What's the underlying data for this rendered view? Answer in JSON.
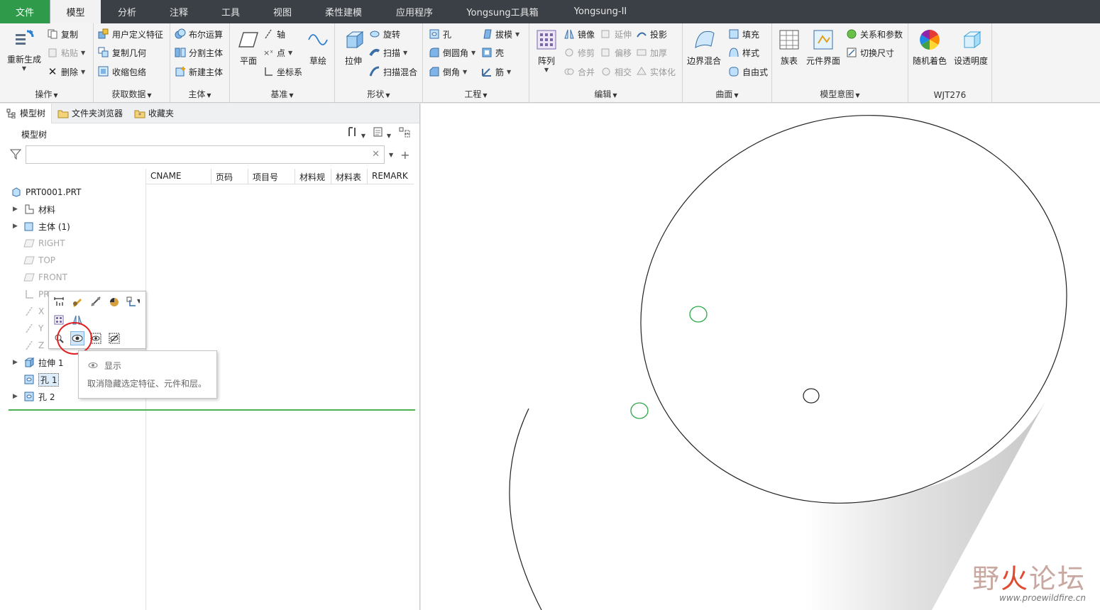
{
  "menu": {
    "tabs": [
      "文件",
      "模型",
      "分析",
      "注释",
      "工具",
      "视图",
      "柔性建模",
      "应用程序",
      "Yongsung工具箱",
      "Yongsung-II"
    ]
  },
  "ribbon": {
    "ops": {
      "footer": "操作",
      "regen": "重新生成",
      "copy": "复制",
      "paste": "粘贴",
      "delete": "删除"
    },
    "getdata": {
      "footer": "获取数据",
      "udf": "用户定义特征",
      "copygeom": "复制几何",
      "shrinkwrap": "收缩包络"
    },
    "body": {
      "footer": "主体",
      "boolean": "布尔运算",
      "split": "分割主体",
      "newbody": "新建主体"
    },
    "datum": {
      "footer": "基准",
      "plane": "平面",
      "axis": "轴",
      "point": "点",
      "csys": "坐标系",
      "sketch": "草绘"
    },
    "shapes": {
      "footer": "形状",
      "extrude": "拉伸",
      "revolve": "旋转",
      "sweep": "扫描",
      "sweepblend": "扫描混合"
    },
    "eng": {
      "footer": "工程",
      "hole": "孔",
      "round": "倒圆角",
      "chamfer": "倒角",
      "draft": "拔模",
      "shell": "壳",
      "rib": "筋"
    },
    "edit": {
      "footer": "编辑",
      "pattern": "阵列",
      "mirror": "镜像",
      "extend": "延伸",
      "project": "投影",
      "trim": "修剪",
      "offset": "偏移",
      "thicken": "加厚",
      "merge": "合并",
      "intersect": "相交",
      "solidify": "实体化"
    },
    "surface": {
      "footer": "曲面",
      "boundary": "边界混合",
      "fill": "填充",
      "style": "样式",
      "freestyle": "自由式"
    },
    "intent": {
      "footer": "模型意图",
      "family": "族表",
      "compif": "元件界面",
      "relparam": "关系和参数",
      "switchdim": "切换尺寸"
    },
    "custom": {
      "footer": "WJT276",
      "randcolor": "随机着色",
      "transparency": "设透明度"
    }
  },
  "panel": {
    "tabs": [
      "模型树",
      "文件夹浏览器",
      "收藏夹"
    ],
    "tree_title": "模型树",
    "columns": [
      "CNAME",
      "页码",
      "项目号",
      "材料规",
      "材料表",
      "REMARK"
    ],
    "nodes": {
      "root": "PRT0001.PRT",
      "material": "材料",
      "body": "主体 (1)",
      "right": "RIGHT",
      "top": "TOP",
      "front": "FRONT",
      "prt_csys": "PR",
      "x": "X",
      "y": "Y",
      "z": "Z",
      "extrude": "拉伸 1",
      "hole1": "孔 1",
      "hole2": "孔 2"
    }
  },
  "tooltip": {
    "title": "显示",
    "desc": "取消隐藏选定特征、元件和层。"
  },
  "watermark": {
    "text1": "野",
    "text2": "火",
    "text3": "论坛",
    "url": "www.proewildfire.cn"
  },
  "colors": {
    "file_tab": "#2e9a4a",
    "menubar": "#3b4046",
    "accent_green": "#4caf50",
    "highlight_red": "#e02020"
  }
}
